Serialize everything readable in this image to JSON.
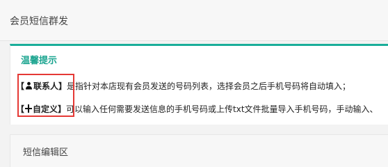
{
  "header": {
    "title": "会员短信群发"
  },
  "tips": {
    "title": "温馨提示",
    "items": [
      {
        "tag_open": "【",
        "icon": "person-icon",
        "label": "联系人",
        "tag_close": "】",
        "text": "是指针对本店现有会员发送的号码列表，选择会员之后手机号码将自动填入；"
      },
      {
        "tag_open": "【",
        "icon": "plus-icon",
        "label": "自定义",
        "tag_close": "】",
        "text": "可以输入任何需要发送信息的手机号码或上传txt文件批量导入手机号码，手动输入、"
      }
    ]
  },
  "editor": {
    "title": "短信编辑区"
  },
  "colors": {
    "accent": "#1aae9a",
    "highlight": "#e53935"
  }
}
